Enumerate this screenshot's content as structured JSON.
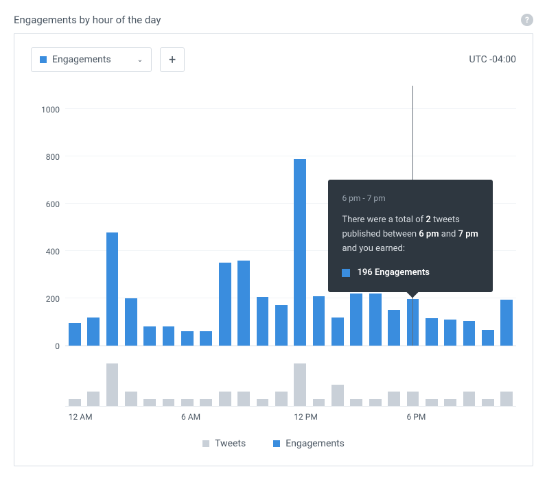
{
  "title": "Engagements by hour of the day",
  "timezone": "UTC -04:00",
  "metric_select": {
    "label": "Engagements",
    "color": "#3a8dde"
  },
  "legend": {
    "tweets": "Tweets",
    "engagements": "Engagements"
  },
  "y_ticks": [
    0,
    200,
    400,
    600,
    800,
    1000
  ],
  "x_ticks": [
    {
      "hour": 0,
      "label": "12 AM"
    },
    {
      "hour": 6,
      "label": "6 AM"
    },
    {
      "hour": 12,
      "label": "12 PM"
    },
    {
      "hour": 18,
      "label": "6 PM"
    }
  ],
  "tooltip": {
    "title": "6 pm - 7 pm",
    "prefix": "There were a total of ",
    "count": "2",
    "mid": " tweets published between ",
    "start": "6 pm",
    "and": " and ",
    "end": "7 pm",
    "suffix": " and you earned:",
    "value": "196 Engagements",
    "hour": 18
  },
  "chart_data": {
    "type": "bar",
    "title": "Engagements by hour of the day",
    "ylabel": "Engagements",
    "ylim": [
      0,
      1100
    ],
    "categories": [
      "12 AM",
      "1 AM",
      "2 AM",
      "3 AM",
      "4 AM",
      "5 AM",
      "6 AM",
      "7 AM",
      "8 AM",
      "9 AM",
      "10 AM",
      "11 AM",
      "12 PM",
      "1 PM",
      "2 PM",
      "3 PM",
      "4 PM",
      "5 PM",
      "6 PM",
      "7 PM",
      "8 PM",
      "9 PM",
      "10 PM",
      "11 PM"
    ],
    "series": [
      {
        "name": "Engagements",
        "values": [
          96,
          120,
          480,
          200,
          80,
          80,
          60,
          60,
          350,
          360,
          205,
          170,
          790,
          210,
          120,
          220,
          220,
          150,
          196,
          115,
          110,
          105,
          68,
          195
        ]
      },
      {
        "name": "Tweets",
        "values": [
          1,
          2,
          6,
          2,
          1,
          1,
          1,
          1,
          2,
          2,
          1,
          2,
          6,
          1,
          3,
          1,
          1,
          2,
          2,
          1,
          1,
          2,
          1,
          2
        ]
      }
    ]
  }
}
